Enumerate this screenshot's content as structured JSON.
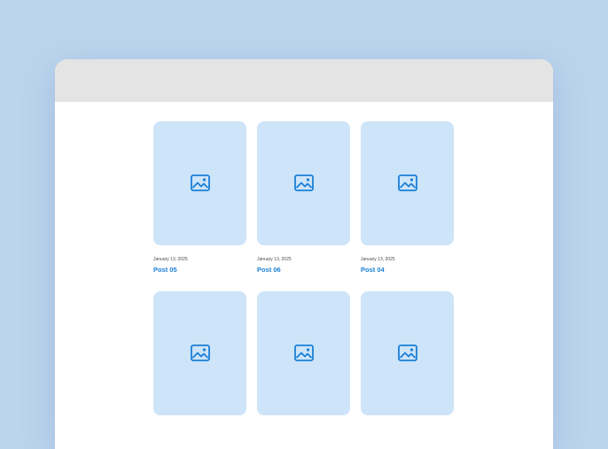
{
  "colors": {
    "background": "#bcd5ee",
    "titlebar": "#e4e4e4",
    "thumbnail": "#cde4f9",
    "accent": "#1a7fd6"
  },
  "posts": [
    {
      "date": "January 13, 2025",
      "title": "Post 05",
      "icon": "image-icon"
    },
    {
      "date": "January 13, 2025",
      "title": "Post 06",
      "icon": "image-icon"
    },
    {
      "date": "January 13, 2025",
      "title": "Post 04",
      "icon": "image-icon"
    },
    {
      "date": "",
      "title": "",
      "icon": "image-icon"
    },
    {
      "date": "",
      "title": "",
      "icon": "image-icon"
    },
    {
      "date": "",
      "title": "",
      "icon": "image-icon"
    }
  ]
}
